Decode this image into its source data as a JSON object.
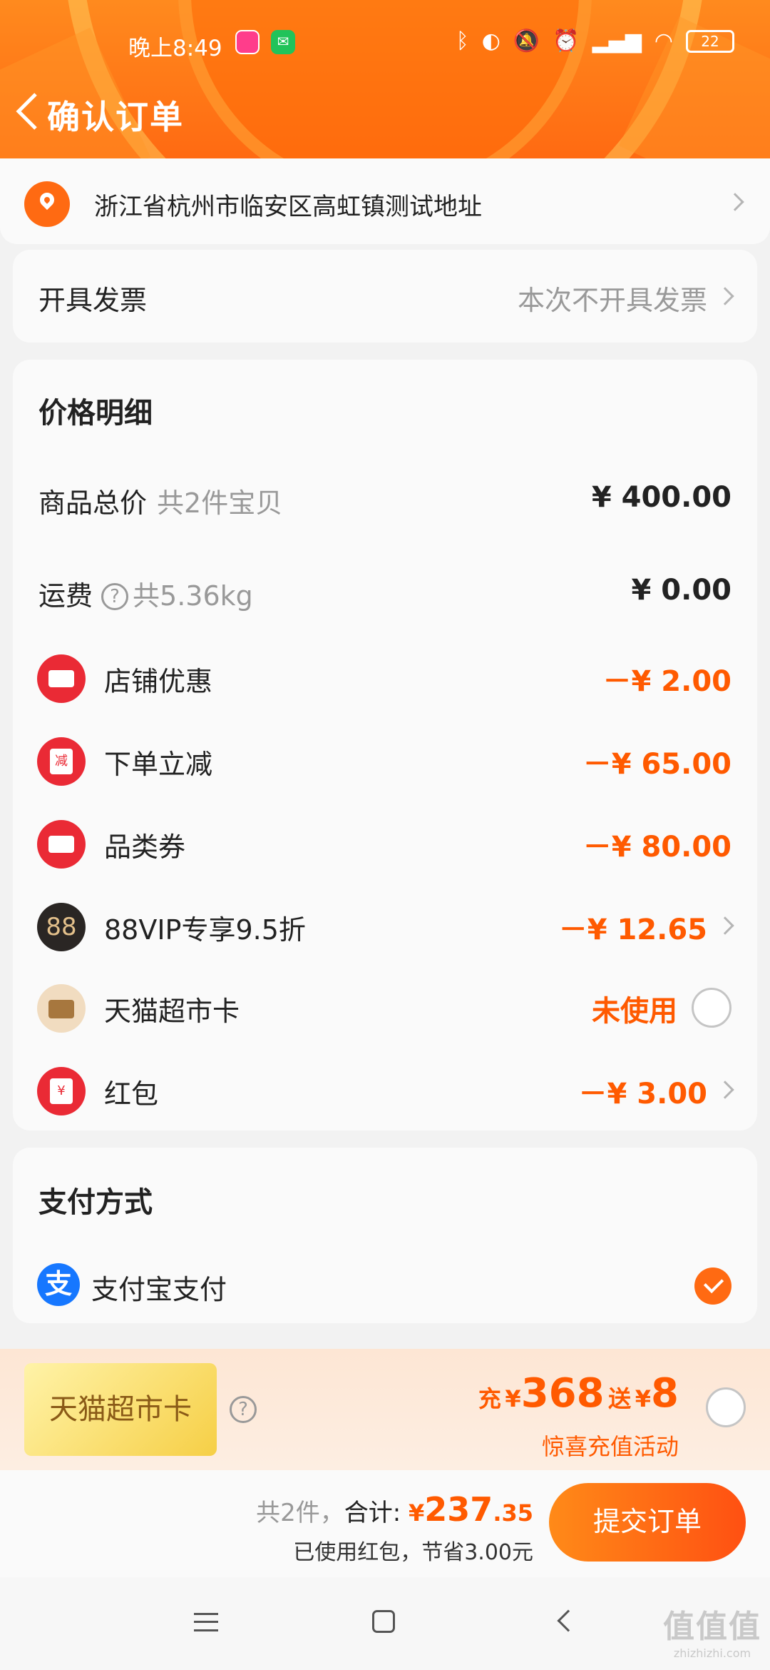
{
  "status_bar": {
    "time": "晚上8:49",
    "battery": "22"
  },
  "header": {
    "title": "确认订单"
  },
  "address": {
    "text": "浙江省杭州市临安区高虹镇测试地址"
  },
  "invoice": {
    "label": "开具发票",
    "value": "本次不开具发票"
  },
  "price_detail": {
    "title": "价格明细",
    "goods_total": {
      "label": "商品总价",
      "sub": "共2件宝贝",
      "amount": "¥ 400.00"
    },
    "shipping": {
      "label": "运费",
      "sub": "共5.36kg",
      "amount": "¥ 0.00"
    },
    "discounts": [
      {
        "label": "店铺优惠",
        "amount": "－¥ 2.00",
        "icon": "shop-coupon-icon"
      },
      {
        "label": "下单立减",
        "amount": "－¥ 65.00",
        "icon": "instant-discount-icon",
        "icon_text": "减"
      },
      {
        "label": "品类券",
        "amount": "－¥ 80.00",
        "icon": "category-coupon-icon"
      },
      {
        "label": "88VIP专享9.5折",
        "amount": "－¥ 12.65",
        "icon": "88vip-icon",
        "icon_text": "88"
      },
      {
        "label": "天猫超市卡",
        "amount": "未使用",
        "icon": "tmall-card-icon"
      },
      {
        "label": "红包",
        "amount": "－¥ 3.00",
        "icon": "red-packet-icon",
        "icon_text": "¥"
      }
    ]
  },
  "payment": {
    "title": "支付方式",
    "method": "支付宝支付",
    "icon_text": "支"
  },
  "promo": {
    "card_label": "天猫超市卡",
    "recharge_prefix": "充",
    "recharge_yen": "¥",
    "recharge_amount": "368",
    "gift_prefix": "送",
    "gift_yen": "¥",
    "gift_amount": "8",
    "subtitle": "惊喜充值活动"
  },
  "checkout": {
    "count": "共2件，",
    "total_label": "合计:",
    "total_yen": "¥",
    "total_int": "237",
    "total_dec": ".35",
    "saved": "已使用红包，节省3.00元",
    "submit": "提交订单"
  },
  "watermark": {
    "main": "值值值",
    "sub": "zhizhizhi.com"
  },
  "colors": {
    "accent": "#ff5a00",
    "header": "#ff6a12",
    "coupon_red": "#ea2a35"
  }
}
